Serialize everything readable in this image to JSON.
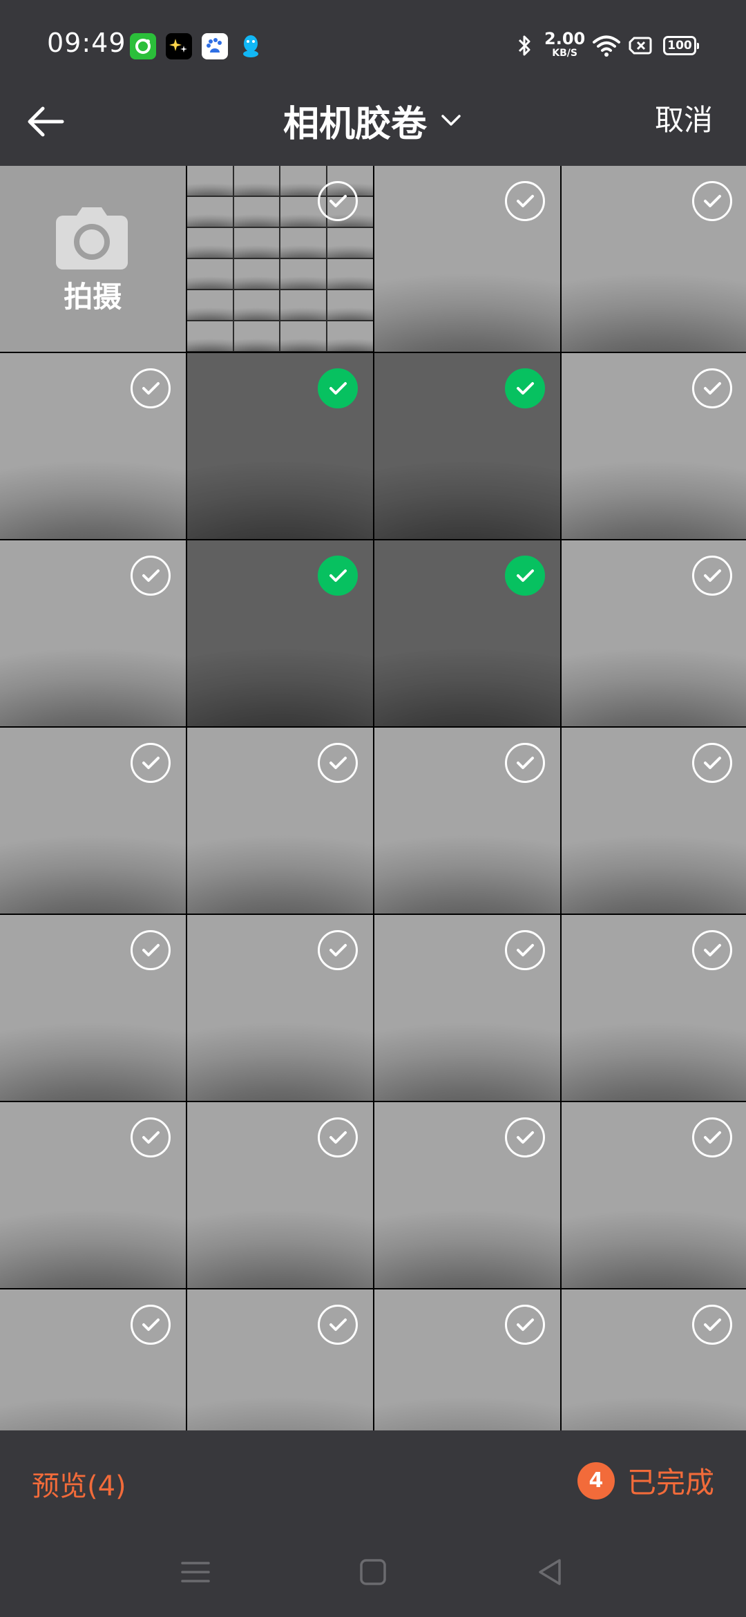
{
  "status_bar": {
    "time": "09:49",
    "network_speed": "2.00",
    "network_speed_unit": "KB/S",
    "battery": "100",
    "apps": [
      "green-app-icon",
      "star-app-icon",
      "baidu-app-icon",
      "qq-app-icon"
    ],
    "indicators": [
      "bluetooth-icon",
      "wifi-icon",
      "sim-off-icon"
    ]
  },
  "header": {
    "title": "相机胶卷",
    "cancel_label": "取消"
  },
  "grid": {
    "camera_label": "拍摄",
    "selected_positions": [
      5,
      6,
      9,
      10
    ],
    "photo_count": 27
  },
  "footer": {
    "preview_label": "预览(4)",
    "selected_count": "4",
    "done_label": "已完成"
  },
  "colors": {
    "bar_background": "#38383c",
    "accent": "#f26b3a",
    "check_selected": "#07c160"
  }
}
